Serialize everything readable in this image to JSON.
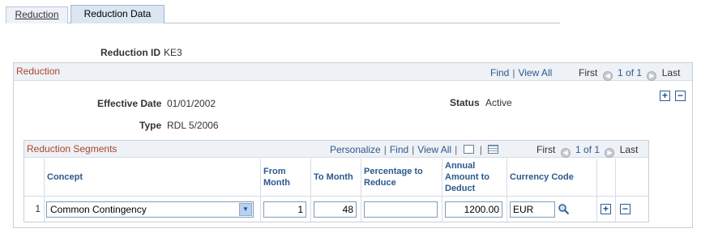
{
  "tabs": [
    {
      "label": "Reduction"
    },
    {
      "label": "Reduction Data"
    }
  ],
  "reduction_id": {
    "label": "Reduction ID",
    "value": "KE3"
  },
  "group": {
    "title": "Reduction",
    "find": "Find",
    "view_all": "View All",
    "first": "First",
    "range": "1 of 1",
    "last": "Last"
  },
  "effective_date": {
    "label": "Effective Date",
    "value": "01/01/2002"
  },
  "status": {
    "label": "Status",
    "value": "Active"
  },
  "type": {
    "label": "Type",
    "value": "RDL 5/2006"
  },
  "grid": {
    "title": "Reduction Segments",
    "personalize": "Personalize",
    "find": "Find",
    "view_all": "View All",
    "first": "First",
    "range": "1 of 1",
    "last": "Last",
    "columns": [
      "Concept",
      "From Month",
      "To Month",
      "Percentage to Reduce",
      "Annual Amount to Deduct",
      "Currency Code"
    ],
    "rows": [
      {
        "num": "1",
        "concept": "Common Contingency",
        "from_month": "1",
        "to_month": "48",
        "percentage": "",
        "annual_amount": "1200.00",
        "currency": "EUR"
      }
    ]
  },
  "icons": {
    "add": "plus-icon",
    "delete": "minus-icon",
    "lookup": "magnifier-icon",
    "zoom": "zoom-icon",
    "download": "download-icon"
  }
}
